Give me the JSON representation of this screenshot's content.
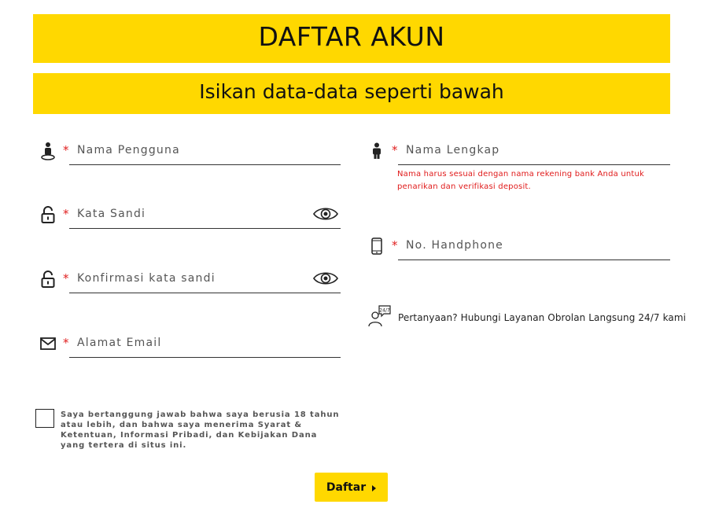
{
  "header": {
    "title": "DAFTAR AKUN",
    "subtitle": "Isikan data-data seperti bawah"
  },
  "fields": {
    "username": {
      "placeholder": "Nama Pengguna",
      "icon": "user-pin-icon",
      "required_mark": "*"
    },
    "password": {
      "placeholder": "Kata Sandi",
      "icon": "lock-icon",
      "required_mark": "*"
    },
    "confirm_password": {
      "placeholder": "Konfirmasi kata sandi",
      "icon": "lock-icon",
      "required_mark": "*"
    },
    "email": {
      "placeholder": "Alamat Email",
      "icon": "mail-icon",
      "required_mark": "*"
    },
    "full_name": {
      "placeholder": "Nama Lengkap",
      "icon": "person-icon",
      "required_mark": "*"
    },
    "phone": {
      "placeholder": "No. Handphone",
      "icon": "phone-icon",
      "required_mark": "*"
    }
  },
  "full_name_hint": "Nama harus sesuai dengan nama rekening bank Anda untuk penarikan dan verifikasi deposit.",
  "help": {
    "text": "Pertanyaan? Hubungi Layanan Obrolan Langsung 24/7 kami",
    "badge": "24/7"
  },
  "terms": {
    "text": "Saya bertanggung jawab bahwa saya berusia 18 tahun atau lebih, dan bahwa saya menerima Syarat & Ketentuan, Informasi Pribadi, dan Kebijakan Dana yang tertera di situs ini.",
    "checked": false
  },
  "submit": {
    "label": "Daftar"
  },
  "colors": {
    "accent": "#ffd800",
    "error": "#e01a1a",
    "text": "#222222"
  }
}
